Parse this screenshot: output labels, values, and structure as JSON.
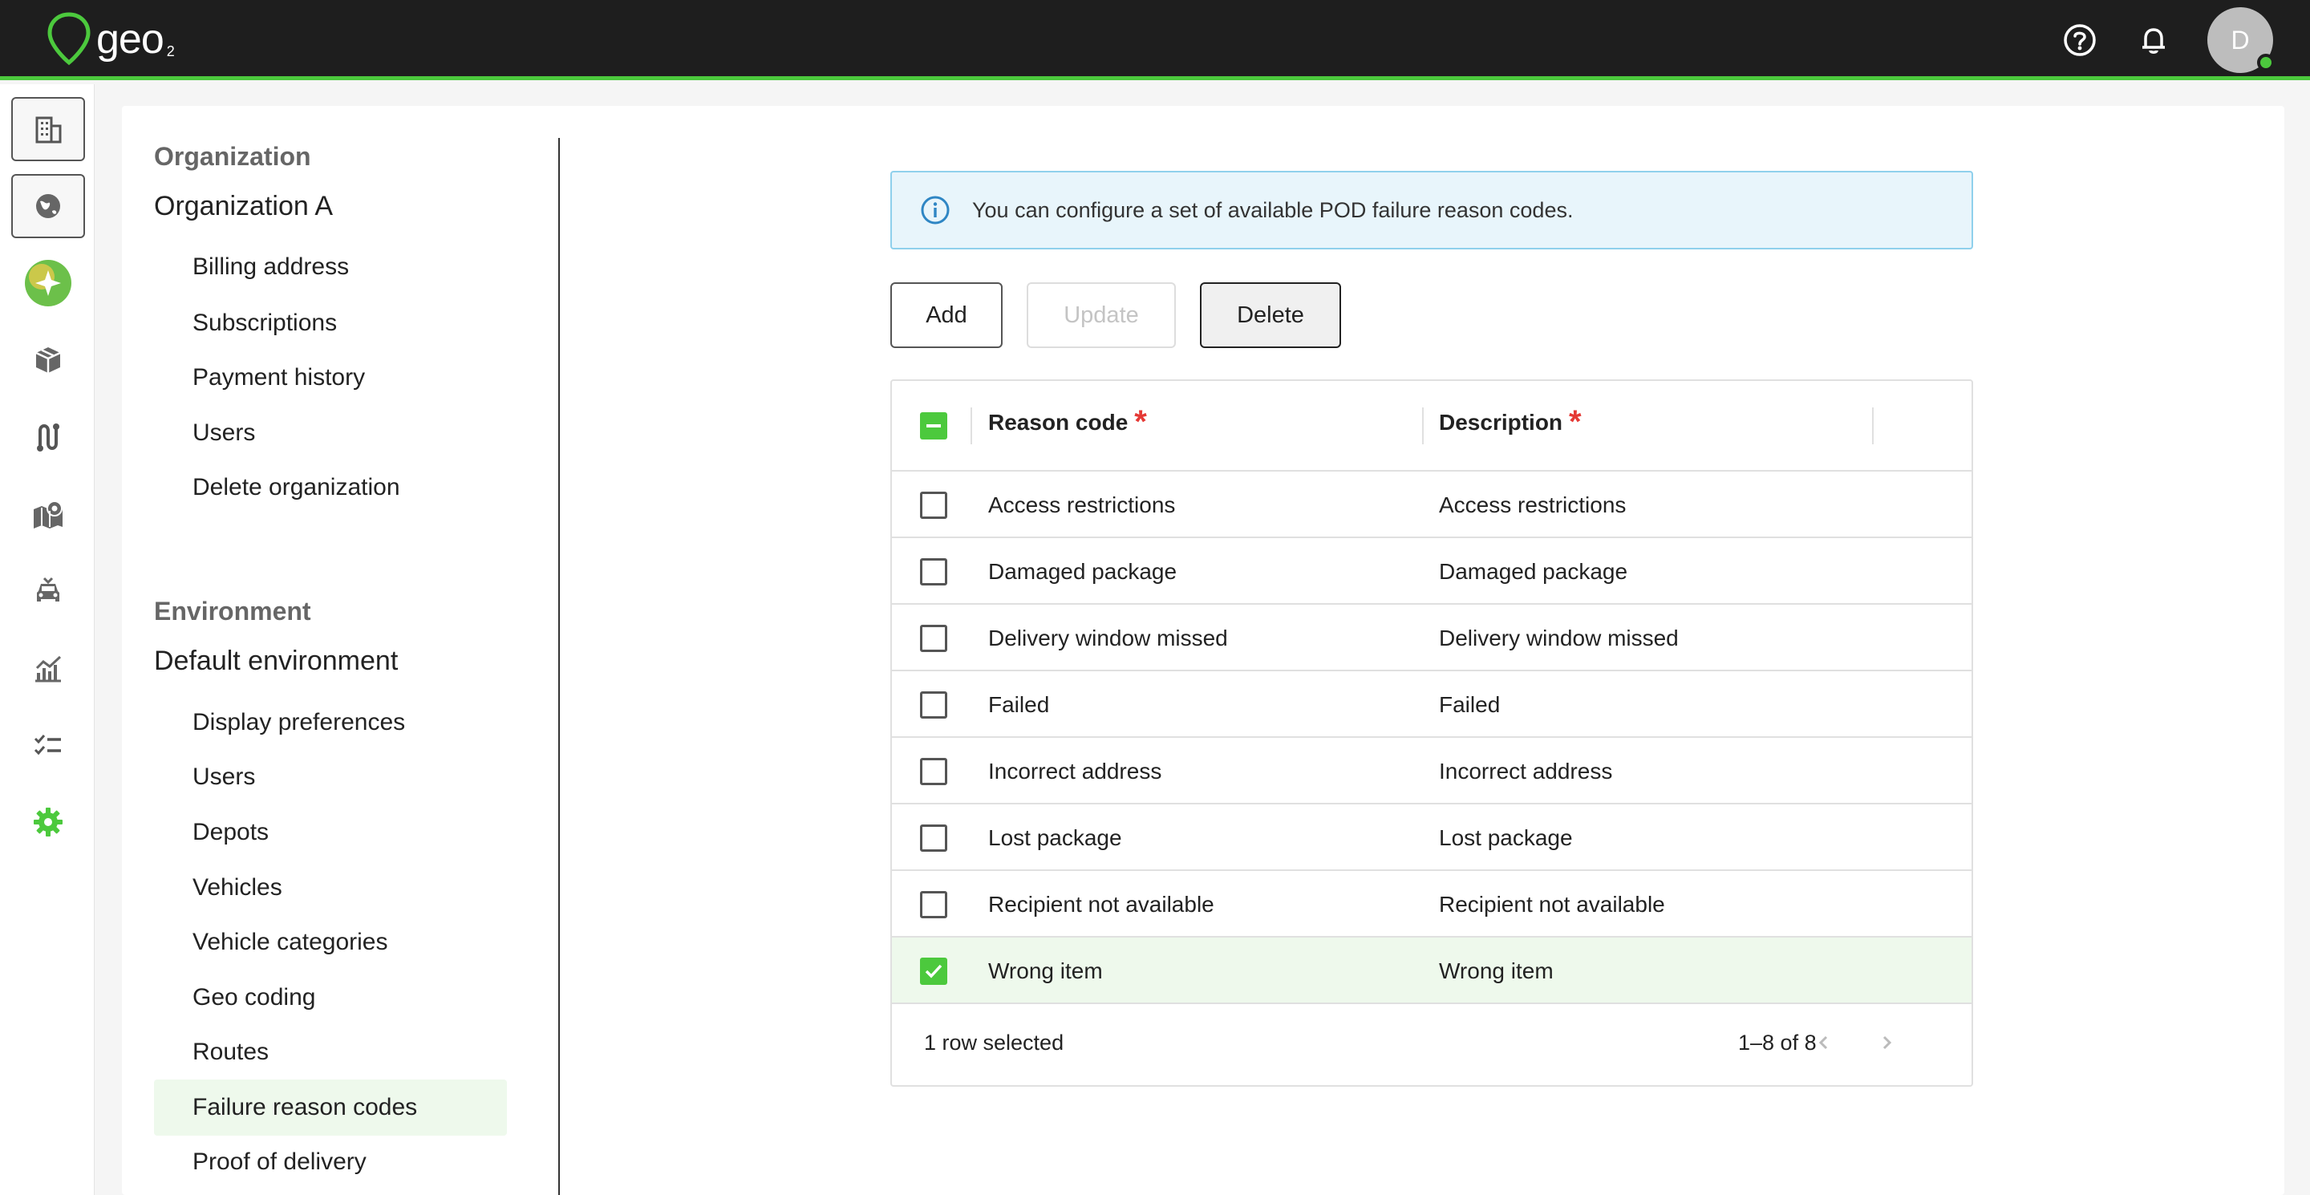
{
  "app": {
    "logo_text": "geo",
    "logo_sub": "2",
    "avatar_initial": "D",
    "accent_color": "#4cc93d"
  },
  "topbar": {
    "icons": [
      "help-icon",
      "bell-icon"
    ]
  },
  "rail": {
    "items": [
      "organization-icon",
      "globe-icon",
      "ai-assistant-icon",
      "package-icon",
      "route-icon",
      "map-icon",
      "vehicle-icon",
      "analytics-icon",
      "checklist-icon",
      "settings-icon"
    ]
  },
  "settings_nav": {
    "org_section": "Organization",
    "org_name": "Organization A",
    "org_items": [
      "Billing address",
      "Subscriptions",
      "Payment history",
      "Users",
      "Delete organization"
    ],
    "env_section": "Environment",
    "env_name": "Default environment",
    "env_items": [
      "Display preferences",
      "Users",
      "Depots",
      "Vehicles",
      "Vehicle categories",
      "Geo coding",
      "Routes",
      "Failure reason codes",
      "Proof of delivery"
    ],
    "active_item": "Failure reason codes"
  },
  "alert": {
    "text": "You can configure a set of available POD failure reason codes."
  },
  "toolbar": {
    "add_label": "Add",
    "update_label": "Update",
    "delete_label": "Delete"
  },
  "table": {
    "columns": [
      "Reason code",
      "Description"
    ],
    "required_marker": "*",
    "rows": [
      {
        "code": "Access restrictions",
        "description": "Access restrictions",
        "checked": false
      },
      {
        "code": "Damaged package",
        "description": "Damaged package",
        "checked": false
      },
      {
        "code": "Delivery window missed",
        "description": "Delivery window missed",
        "checked": false
      },
      {
        "code": "Failed",
        "description": "Failed",
        "checked": false
      },
      {
        "code": "Incorrect address",
        "description": "Incorrect address",
        "checked": false
      },
      {
        "code": "Lost package",
        "description": "Lost package",
        "checked": false
      },
      {
        "code": "Recipient not available",
        "description": "Recipient not available",
        "checked": false
      },
      {
        "code": "Wrong item",
        "description": "Wrong item",
        "checked": true
      }
    ],
    "selection_text": "1 row selected",
    "pagination_text": "1–8 of 8"
  }
}
